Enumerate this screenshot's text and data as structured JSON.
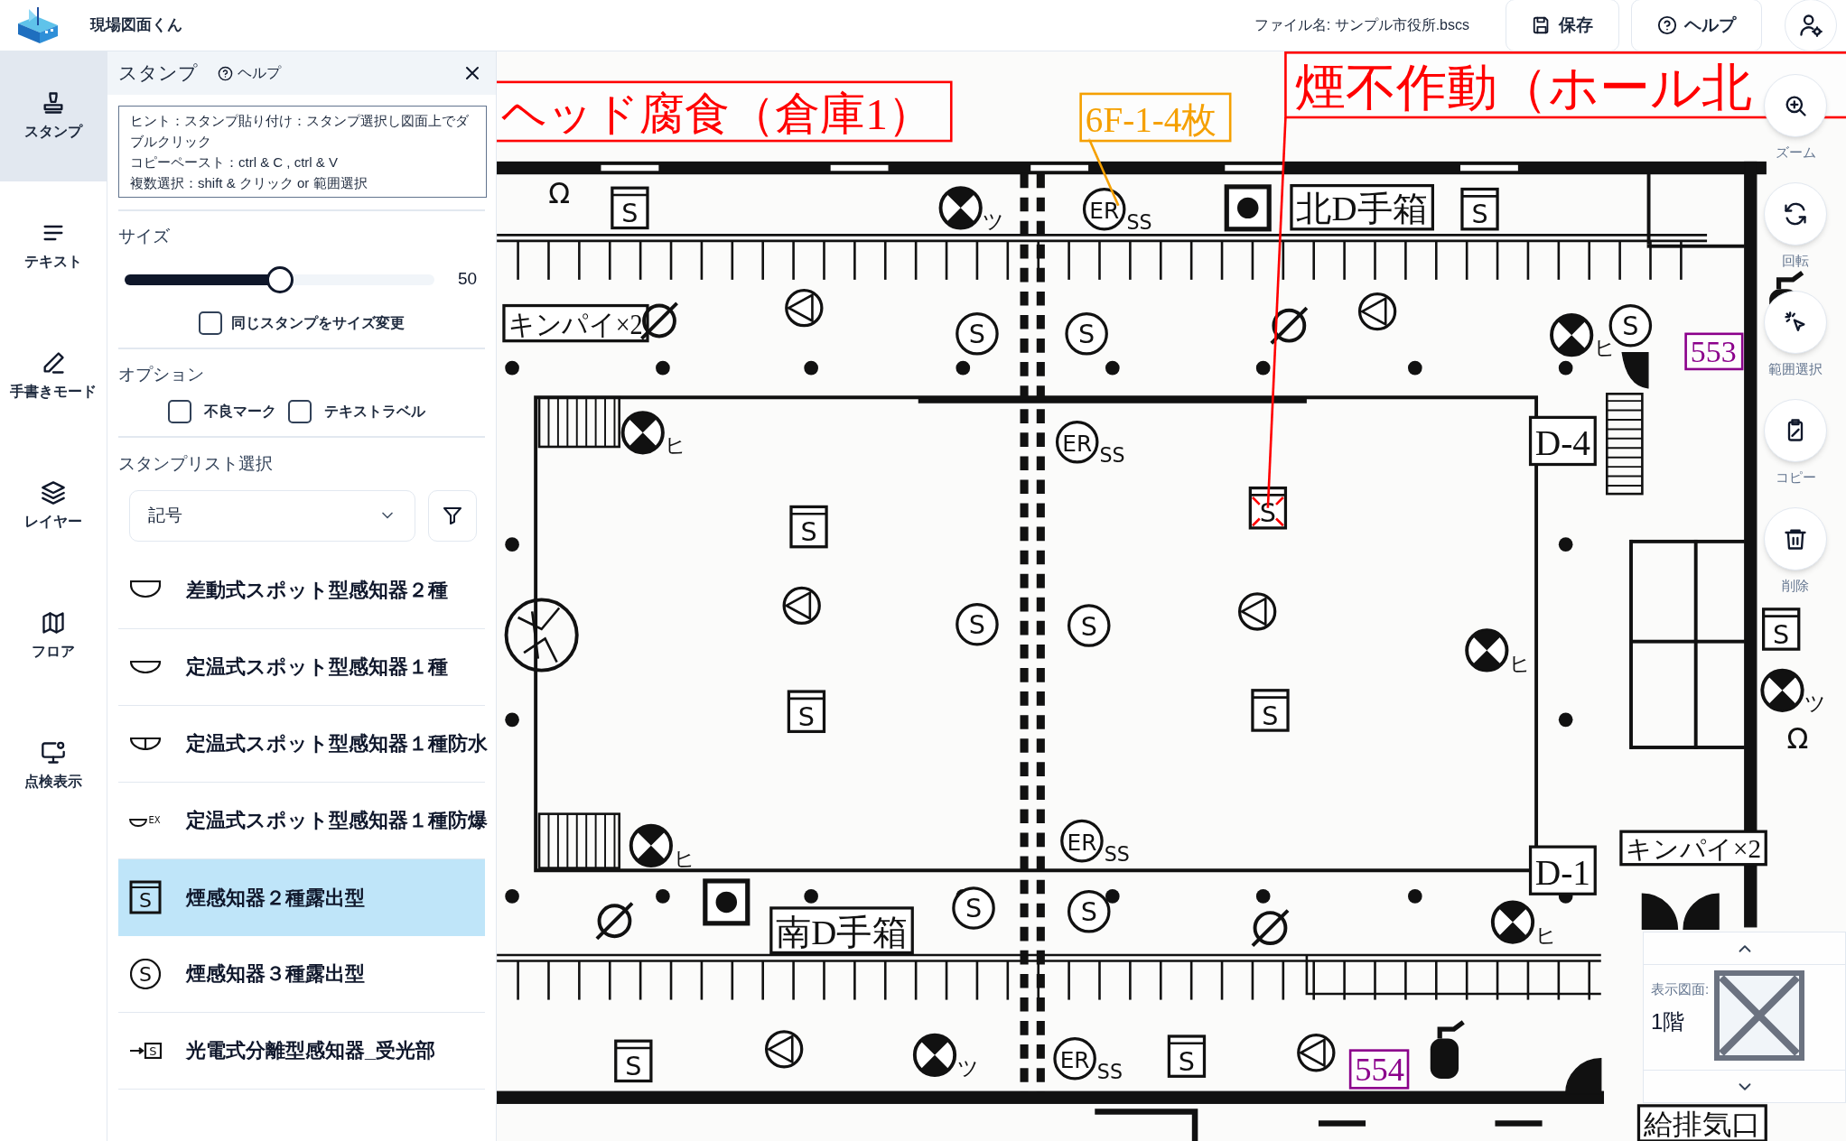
{
  "app": {
    "title": "現場図面くん"
  },
  "header": {
    "file_name": "ファイル名: サンプル市役所.bscs",
    "buttons": [
      {
        "label": "保存",
        "kind": "save"
      },
      {
        "label": "ヘルプ",
        "kind": "help"
      }
    ]
  },
  "rail": [
    {
      "label": "スタンプ",
      "kind": "stamp",
      "selected": true
    },
    {
      "label": "テキスト",
      "kind": "text",
      "selected": false
    },
    {
      "label": "手書きモード",
      "kind": "pen",
      "selected": false
    },
    {
      "label": "レイヤー",
      "kind": "layers",
      "selected": false
    },
    {
      "label": "フロア",
      "kind": "floor",
      "selected": false
    },
    {
      "label": "点検表示",
      "kind": "inspection",
      "selected": false
    }
  ],
  "panel": {
    "title": "スタンプ",
    "help": "ヘルプ",
    "hint": [
      "ヒント：スタンプ貼り付け：スタンプ選択し図面上でダブルクリック",
      "コピーペースト：ctrl & C , ctrl & V",
      "複数選択：shift & クリック or 範囲選択"
    ],
    "size": {
      "label": "サイズ",
      "level": 0.5,
      "reading": "50",
      "resize_same": {
        "label": "同じスタンプをサイズ変更",
        "checked": false
      }
    },
    "options": {
      "label": "オプション",
      "items": [
        {
          "label": "不良マーク",
          "checked": false
        },
        {
          "label": "テキストラベル",
          "checked": false
        }
      ]
    },
    "list_select": {
      "label": "スタンプリスト選択",
      "value": "記号"
    },
    "stamps": [
      {
        "label": "差動式スポット型感知器２種",
        "kind": "heat_diff",
        "selected": false
      },
      {
        "label": "定温式スポット型感知器１種",
        "kind": "heat_fixed",
        "selected": false
      },
      {
        "label": "定温式スポット型感知器１種防水",
        "kind": "heat_water",
        "selected": false
      },
      {
        "label": "定温式スポット型感知器１種防爆",
        "kind": "heat_ex",
        "mark": "EX",
        "selected": false
      },
      {
        "label": "煙感知器２種露出型",
        "kind": "smoke_box",
        "mark": "S",
        "selected": true
      },
      {
        "label": "煙感知器３種露出型",
        "kind": "smoke_circle",
        "mark": "S",
        "selected": false
      },
      {
        "label": "光電式分離型感知器_受光部",
        "kind": "beam",
        "mark": "S",
        "selected": false
      }
    ]
  },
  "canvas": {
    "annotations": [
      {
        "text": "ヘッド腐食（倉庫1）",
        "color": "#ff0000"
      },
      {
        "text": "煙不作動（ホール北",
        "color": "#ff0000"
      },
      {
        "text": "6F-1-4枚",
        "color": "#f5a000"
      },
      {
        "text": "553",
        "color": "#8b008b"
      },
      {
        "text": "554",
        "color": "#8b008b"
      }
    ],
    "plan_labels": [
      {
        "text": "北D手箱",
        "kind": "framed"
      },
      {
        "text": "キンパイ×2",
        "kind": "framed"
      },
      {
        "text": "D-4",
        "kind": "framed"
      },
      {
        "text": "南D手箱",
        "kind": "framed"
      },
      {
        "text": "D-1",
        "kind": "framed"
      },
      {
        "text": "キンパイ×2",
        "kind": "framed"
      },
      {
        "text": "給排気口",
        "kind": "framed"
      },
      {
        "text": "Ω",
        "kind": "plain"
      },
      {
        "text": "Ω",
        "kind": "plain"
      }
    ],
    "symbols": [
      {
        "kind": "box",
        "mark": "S",
        "flagged": false
      },
      {
        "kind": "cross",
        "suffix": "ツ"
      },
      {
        "kind": "circle",
        "mark": "ER",
        "suffix": "SS"
      },
      {
        "kind": "box",
        "mark": "S",
        "flagged": false
      },
      {
        "kind": "slash"
      },
      {
        "kind": "triangle"
      },
      {
        "kind": "circle",
        "mark": "S"
      },
      {
        "kind": "circle",
        "mark": "S"
      },
      {
        "kind": "slash"
      },
      {
        "kind": "triangle"
      },
      {
        "kind": "cross",
        "suffix": "ヒ"
      },
      {
        "kind": "circle",
        "mark": "S"
      },
      {
        "kind": "cross",
        "suffix": "ヒ"
      },
      {
        "kind": "circle",
        "mark": "ER",
        "suffix": "SS"
      },
      {
        "kind": "box",
        "mark": "S",
        "flagged": false
      },
      {
        "kind": "box",
        "mark": "S",
        "flagged": true
      },
      {
        "kind": "triangle"
      },
      {
        "kind": "circle",
        "mark": "S"
      },
      {
        "kind": "circle",
        "mark": "S"
      },
      {
        "kind": "triangle"
      },
      {
        "kind": "cross",
        "suffix": "ヒ"
      },
      {
        "kind": "box",
        "mark": "S",
        "flagged": false
      },
      {
        "kind": "box",
        "mark": "S",
        "flagged": false
      },
      {
        "kind": "box",
        "mark": "S",
        "flagged": false
      },
      {
        "kind": "cross",
        "suffix": "ツ"
      },
      {
        "kind": "cross",
        "suffix": "ヒ"
      },
      {
        "kind": "circle",
        "mark": "ER",
        "suffix": "SS"
      },
      {
        "kind": "slash"
      },
      {
        "kind": "circle",
        "mark": "S"
      },
      {
        "kind": "circle",
        "mark": "S"
      },
      {
        "kind": "slash"
      },
      {
        "kind": "cross",
        "suffix": "ヒ"
      },
      {
        "kind": "box",
        "mark": "S",
        "flagged": false
      },
      {
        "kind": "triangle"
      },
      {
        "kind": "cross",
        "suffix": "ツ"
      },
      {
        "kind": "circle",
        "mark": "ER",
        "suffix": "SS"
      },
      {
        "kind": "box",
        "mark": "S",
        "flagged": false
      },
      {
        "kind": "triangle"
      },
      {
        "kind": "dot_box"
      },
      {
        "kind": "dot_box"
      }
    ],
    "tools": [
      {
        "label": "ズーム",
        "kind": "zoom"
      },
      {
        "label": "回転",
        "kind": "rotate"
      },
      {
        "label": "範囲選択",
        "kind": "select"
      },
      {
        "label": "コピー",
        "kind": "copy"
      },
      {
        "label": "削除",
        "kind": "delete"
      }
    ],
    "floor_selector": {
      "label": "表示図面:",
      "value": "1階"
    }
  }
}
